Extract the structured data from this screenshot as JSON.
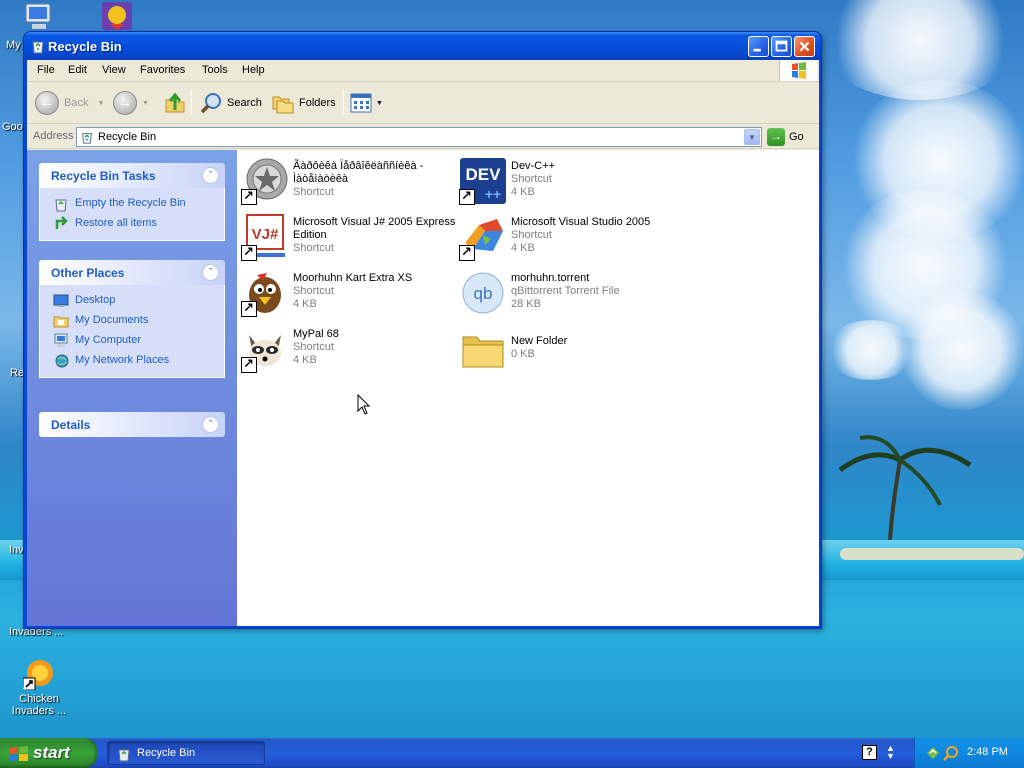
{
  "desktop": {
    "icons": [
      {
        "label": "My"
      },
      {
        "label": "Goo"
      },
      {
        "label": "Re"
      },
      {
        "label": "Inv"
      },
      {
        "label": "Invaders ..."
      },
      {
        "label": "Chicken Invaders ..."
      }
    ]
  },
  "window": {
    "title": "Recycle Bin",
    "menu": [
      "File",
      "Edit",
      "View",
      "Favorites",
      "Tools",
      "Help"
    ],
    "toolbar": {
      "back": "Back",
      "search": "Search",
      "folders": "Folders"
    },
    "address": {
      "label": "Address",
      "value": "Recycle Bin",
      "go": "Go"
    },
    "taskpane": {
      "tasks_title": "Recycle Bin Tasks",
      "tasks": [
        "Empty the Recycle Bin",
        "Restore all items"
      ],
      "places_title": "Other Places",
      "places": [
        "Desktop",
        "My Documents",
        "My Computer",
        "My Network Places"
      ],
      "details_title": "Details"
    },
    "items": [
      {
        "name": "Ãàðôèêà Ïåðâîêëàññíèêà - Ìàòåìàòèêà",
        "type": "Shortcut",
        "size": ""
      },
      {
        "name": "Dev-C++",
        "type": "Shortcut",
        "size": "4 KB"
      },
      {
        "name": "Microsoft Visual J# 2005 Express Edition",
        "type": "Shortcut",
        "size": ""
      },
      {
        "name": "Microsoft Visual Studio 2005",
        "type": "Shortcut",
        "size": "4 KB"
      },
      {
        "name": "Moorhuhn Kart Extra XS",
        "type": "Shortcut",
        "size": "4 KB"
      },
      {
        "name": "morhuhn.torrent",
        "type": "qBittorrent Torrent File",
        "size": "28 KB"
      },
      {
        "name": "MyPal 68",
        "type": "Shortcut",
        "size": "4 KB"
      },
      {
        "name": "New Folder",
        "type": "",
        "size": "0 KB"
      }
    ]
  },
  "taskbar": {
    "start": "start",
    "task": "Recycle Bin",
    "clock": "2:48 PM"
  },
  "icons": {
    "dev_label": "DEV",
    "vj_label": "VJ#",
    "qb_label": "qb",
    "help_glyph": "?"
  },
  "colors": {
    "title_blue": "#0651dd",
    "taskpane_link": "#215dc6",
    "start_green": "#3aa33a",
    "tray_blue": "#0f88e0"
  }
}
